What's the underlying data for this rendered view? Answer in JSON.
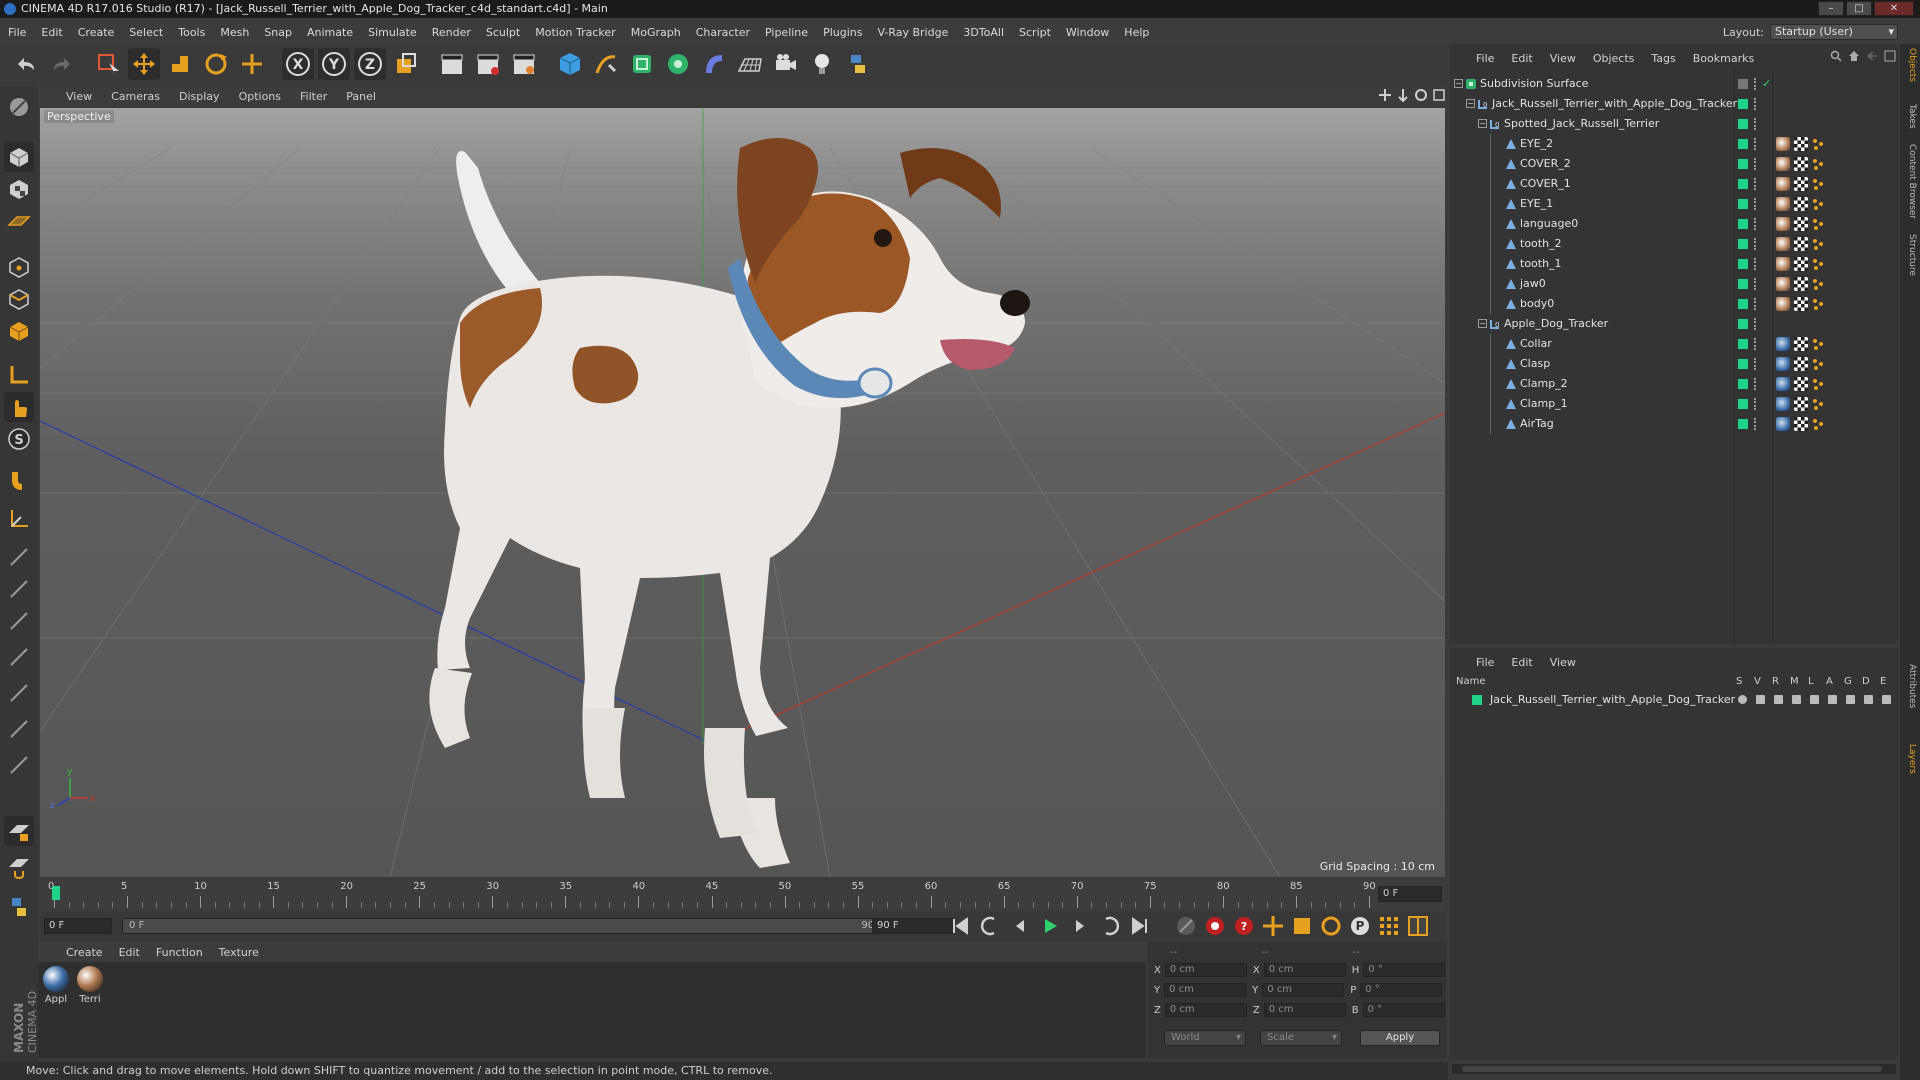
{
  "window": {
    "title": "CINEMA 4D R17.016 Studio (R17) - [Jack_Russell_Terrier_with_Apple_Dog_Tracker_c4d_standart.c4d] - Main"
  },
  "menubar": {
    "items": [
      "File",
      "Edit",
      "Create",
      "Select",
      "Tools",
      "Mesh",
      "Snap",
      "Animate",
      "Simulate",
      "Render",
      "Sculpt",
      "Motion Tracker",
      "MoGraph",
      "Character",
      "Pipeline",
      "Plugins",
      "V-Ray Bridge",
      "3DToAll",
      "Script",
      "Window",
      "Help"
    ],
    "layout_label": "Layout:",
    "layout_value": "Startup (User)"
  },
  "toolbar": {
    "axis_x": "X",
    "axis_y": "Y",
    "axis_z": "Z"
  },
  "viewport": {
    "menu": [
      "View",
      "Cameras",
      "Display",
      "Options",
      "Filter",
      "Panel"
    ],
    "camera_label": "Perspective",
    "grid_spacing": "Grid Spacing : 10 cm"
  },
  "timeline": {
    "ticks": [
      "0",
      "5",
      "10",
      "15",
      "20",
      "25",
      "30",
      "35",
      "40",
      "45",
      "50",
      "55",
      "60",
      "65",
      "70",
      "75",
      "80",
      "85",
      "90"
    ],
    "current_frame": "0 F",
    "start_frame": "0 F",
    "range_start": "0 F",
    "range_end": "90 F",
    "end_frame": "90 F"
  },
  "material_manager": {
    "menu": [
      "Create",
      "Edit",
      "Function",
      "Texture"
    ],
    "materials": [
      {
        "label": "Appl",
        "color": "#3e6fa8"
      },
      {
        "label": "Terri",
        "color": "#b07a52"
      }
    ]
  },
  "coordinates": {
    "header_a": "--",
    "header_b": "--",
    "header_c": "--",
    "rows": [
      {
        "a": "X",
        "av": "0 cm",
        "b": "X",
        "bv": "0 cm",
        "c": "H",
        "cv": "0 °"
      },
      {
        "a": "Y",
        "av": "0 cm",
        "b": "Y",
        "bv": "0 cm",
        "c": "P",
        "cv": "0 °"
      },
      {
        "a": "Z",
        "av": "0 cm",
        "b": "Z",
        "bv": "0 cm",
        "c": "B",
        "cv": "0 °"
      }
    ],
    "mode": "World",
    "type": "Scale",
    "apply": "Apply"
  },
  "object_manager": {
    "menu": [
      "File",
      "Edit",
      "View",
      "Objects",
      "Tags",
      "Bookmarks"
    ],
    "objects": [
      {
        "name": "Subdivision Surface",
        "level": 0,
        "kind": "subdiv"
      },
      {
        "name": "Jack_Russell_Terrier_with_Apple_Dog_Tracker",
        "level": 1,
        "kind": "null"
      },
      {
        "name": "Spotted_Jack_Russell_Terrier",
        "level": 2,
        "kind": "null"
      },
      {
        "name": "EYE_2",
        "level": 3,
        "kind": "poly",
        "tag": "dog"
      },
      {
        "name": "COVER_2",
        "level": 3,
        "kind": "poly",
        "tag": "dog"
      },
      {
        "name": "COVER_1",
        "level": 3,
        "kind": "poly",
        "tag": "dog"
      },
      {
        "name": "EYE_1",
        "level": 3,
        "kind": "poly",
        "tag": "dog"
      },
      {
        "name": "language0",
        "level": 3,
        "kind": "poly",
        "tag": "dog"
      },
      {
        "name": "tooth_2",
        "level": 3,
        "kind": "poly",
        "tag": "dog"
      },
      {
        "name": "tooth_1",
        "level": 3,
        "kind": "poly",
        "tag": "dog"
      },
      {
        "name": "jaw0",
        "level": 3,
        "kind": "poly",
        "tag": "dog"
      },
      {
        "name": "body0",
        "level": 3,
        "kind": "poly",
        "tag": "dog"
      },
      {
        "name": "Apple_Dog_Tracker",
        "level": 2,
        "kind": "null"
      },
      {
        "name": "Collar",
        "level": 3,
        "kind": "poly",
        "tag": "blue"
      },
      {
        "name": "Clasp",
        "level": 3,
        "kind": "poly",
        "tag": "blue"
      },
      {
        "name": "Clamp_2",
        "level": 3,
        "kind": "poly",
        "tag": "blue"
      },
      {
        "name": "Clamp_1",
        "level": 3,
        "kind": "poly",
        "tag": "blue"
      },
      {
        "name": "AirTag",
        "level": 3,
        "kind": "poly",
        "tag": "blue"
      }
    ]
  },
  "layer_manager": {
    "menu": [
      "File",
      "Edit",
      "View"
    ],
    "columns": [
      "Name",
      "S",
      "V",
      "R",
      "M",
      "L",
      "A",
      "G",
      "D",
      "E"
    ],
    "layers": [
      {
        "name": "Jack_Russell_Terrier_with_Apple_Dog_Tracker",
        "color": "#1fd48a"
      }
    ]
  },
  "right_tabs": [
    "Objects",
    "Takes",
    "Content Browser",
    "Structure",
    "Attributes",
    "Layers"
  ],
  "logo": {
    "line1": "MAXON",
    "line2": "CINEMA 4D"
  },
  "status": {
    "message": "Move: Click and drag to move elements. Hold down SHIFT to quantize movement / add to the selection in point mode, CTRL to remove."
  }
}
